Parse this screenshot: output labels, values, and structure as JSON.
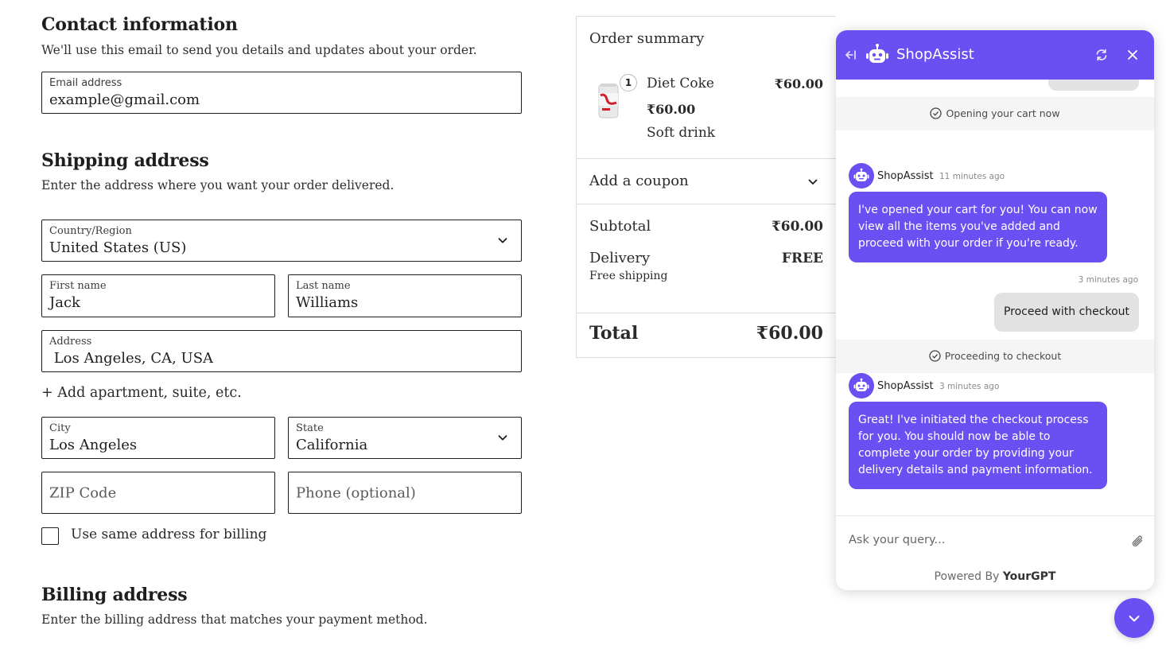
{
  "contact": {
    "heading": "Contact information",
    "description": "We'll use this email to send you details and updates about your order.",
    "email_label": "Email address",
    "email_value": "example@gmail.com"
  },
  "shipping": {
    "heading": "Shipping address",
    "description": "Enter the address where you want your order delivered.",
    "country_label": "Country/Region",
    "country_value": "United States (US)",
    "first_name_label": "First name",
    "first_name_value": "Jack",
    "last_name_label": "Last name",
    "last_name_value": "Williams",
    "address_label": "Address",
    "address_value": " Los Angeles, CA, USA",
    "add_apartment": "+ Add apartment, suite, etc.",
    "city_label": "City",
    "city_value": "Los Angeles",
    "state_label": "State",
    "state_value": "California",
    "zip_placeholder": "ZIP Code",
    "phone_placeholder": "Phone (optional)",
    "same_billing_label": "Use same address for billing"
  },
  "billing": {
    "heading": "Billing address",
    "description": "Enter the billing address that matches your payment method."
  },
  "summary": {
    "title": "Order summary",
    "product": {
      "name": "Diet Coke",
      "quantity": "1",
      "line_price": "₹60.00",
      "unit_price": "₹60.00",
      "description": "Soft drink"
    },
    "coupon_label": "Add a coupon",
    "subtotal_label": "Subtotal",
    "subtotal_value": "₹60.00",
    "delivery_label": "Delivery",
    "delivery_value": "FREE",
    "delivery_note": "Free shipping",
    "total_label": "Total",
    "total_value": "₹60.00"
  },
  "chat": {
    "title": "ShopAssist",
    "accent_color": "#6a4ff2",
    "system_1": "Opening your cart now",
    "msg_1_sender": "ShopAssist",
    "msg_1_time": "11 minutes ago",
    "msg_1_text": "I've opened your cart for you! You can now view all the items you've added and proceed with your order if you're ready.",
    "user_time": "3 minutes ago",
    "user_msg": "Proceed with checkout",
    "system_2": "Proceeding to checkout",
    "msg_2_sender": "ShopAssist",
    "msg_2_time": "3 minutes ago",
    "msg_2_text": "Great! I've initiated the checkout process for you. You should now be able to complete your order by providing your delivery details and payment information.",
    "input_placeholder": "Ask your query...",
    "powered_prefix": "Powered By",
    "powered_brand": "YourGPT"
  }
}
